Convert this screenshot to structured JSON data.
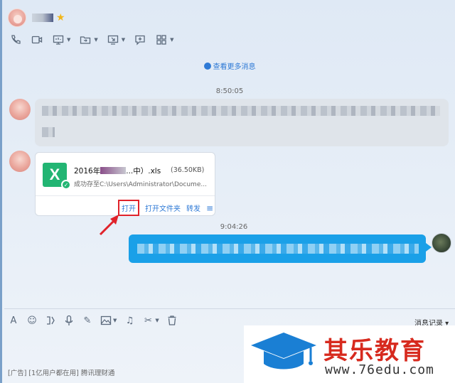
{
  "header": {
    "star_icon": "★"
  },
  "toolbar": {
    "icons": [
      "phone-icon",
      "video-icon",
      "screen-share-icon",
      "transfer-file-icon",
      "remote-desktop-icon",
      "add-chat-icon",
      "apps-grid-icon"
    ]
  },
  "chat": {
    "more_messages_label": "查看更多消息",
    "time_1": "8:50:05",
    "time_2": "9:04:26",
    "file_card": {
      "file_name_prefix": "2016年",
      "file_name_suffix": "...中）.xls",
      "file_size": "(36.50KB)",
      "saved_path": "成功存至C:\\Users\\Administrator\\Docume...",
      "icon_letter": "X",
      "action_open": "打开",
      "action_open_folder": "打开文件夹",
      "action_forward": "转发",
      "menu_glyph": "≡"
    }
  },
  "input": {
    "history_label": "消息记录 ▾"
  },
  "ad_text": "[广告] [1亿用户都在用] 腾讯理财通",
  "watermark": {
    "title": "其乐教育",
    "url": "www.76edu.com"
  },
  "colors": {
    "accent_blue": "#2f7ad6",
    "bubble_blue": "#1aa0e8",
    "excel_green": "#22b573",
    "highlight_red": "#e0222a",
    "watermark_red": "#d72a1e"
  }
}
